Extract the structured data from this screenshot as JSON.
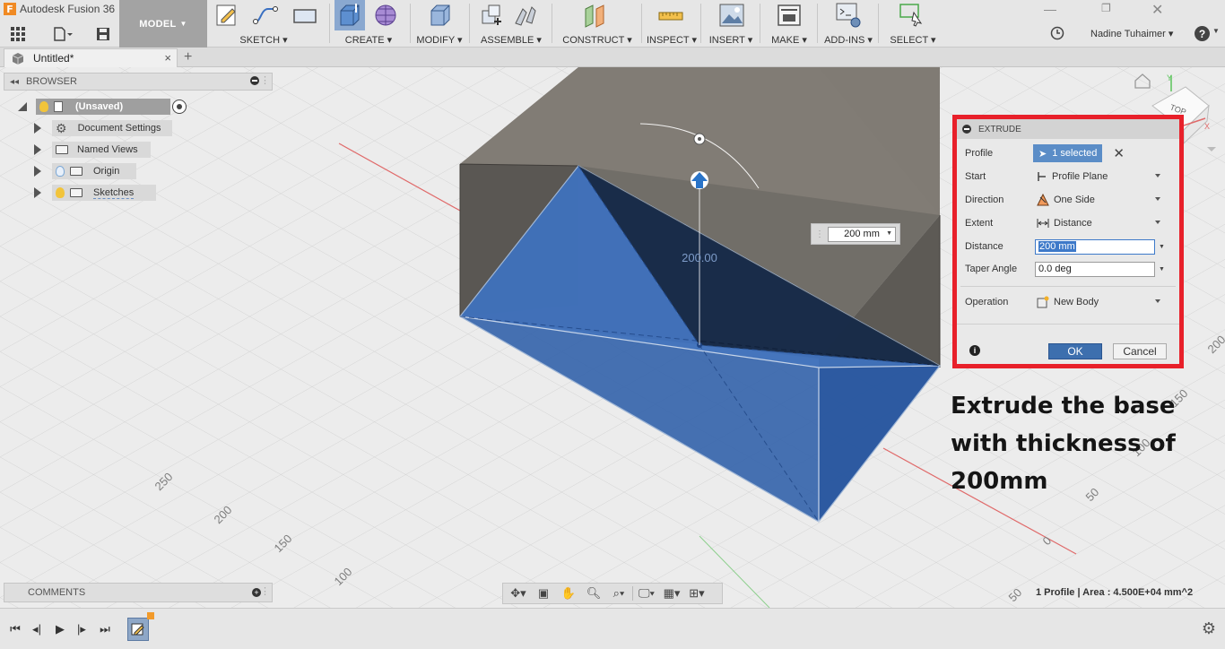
{
  "app": {
    "title": "Autodesk Fusion 36",
    "logo_letter": "F"
  },
  "workspace": {
    "label": "MODEL"
  },
  "toolbar": {
    "groups": [
      {
        "label": "SKETCH"
      },
      {
        "label": "CREATE"
      },
      {
        "label": "MODIFY"
      },
      {
        "label": "ASSEMBLE"
      },
      {
        "label": "CONSTRUCT"
      },
      {
        "label": "INSPECT"
      },
      {
        "label": "INSERT"
      },
      {
        "label": "MAKE"
      },
      {
        "label": "ADD-INS"
      },
      {
        "label": "SELECT"
      }
    ]
  },
  "user": {
    "name": "Nadine Tuhaimer",
    "help_label": "?"
  },
  "tab": {
    "title": "Untitled*",
    "close": "×",
    "add": "+"
  },
  "browser": {
    "title": "BROWSER",
    "items": [
      {
        "label": "(Unsaved)"
      },
      {
        "label": "Document Settings"
      },
      {
        "label": "Named Views"
      },
      {
        "label": "Origin"
      },
      {
        "label": "Sketches"
      }
    ]
  },
  "viewport": {
    "dimension_input": "200 mm",
    "dimension_label": "200.00",
    "grid_labels": [
      "250",
      "200",
      "150",
      "100",
      "50",
      "0",
      "50",
      "100",
      "150",
      "200"
    ],
    "viewcube": {
      "face": "TOP",
      "x": "X",
      "y": "Y"
    }
  },
  "extrude": {
    "title": "EXTRUDE",
    "profile": {
      "label": "Profile",
      "value": "1 selected"
    },
    "start": {
      "label": "Start",
      "value": "Profile Plane"
    },
    "direction": {
      "label": "Direction",
      "value": "One Side"
    },
    "extent": {
      "label": "Extent",
      "value": "Distance"
    },
    "distance": {
      "label": "Distance",
      "value": "200 mm"
    },
    "taper": {
      "label": "Taper Angle",
      "value": "0.0 deg"
    },
    "operation": {
      "label": "Operation",
      "value": "New Body"
    },
    "ok": "OK",
    "cancel": "Cancel"
  },
  "annotation": {
    "line1": "Extrude the base",
    "line2": "with thickness of",
    "line3": "200mm"
  },
  "comments": {
    "title": "COMMENTS"
  },
  "status": {
    "text": "1 Profile | Area : 4.500E+04 mm^2"
  },
  "colors": {
    "accent_blue": "#2f5fad",
    "highlight_red": "#e8202a",
    "body_gray": "#807b74",
    "ok_button": "#3d6fae"
  }
}
